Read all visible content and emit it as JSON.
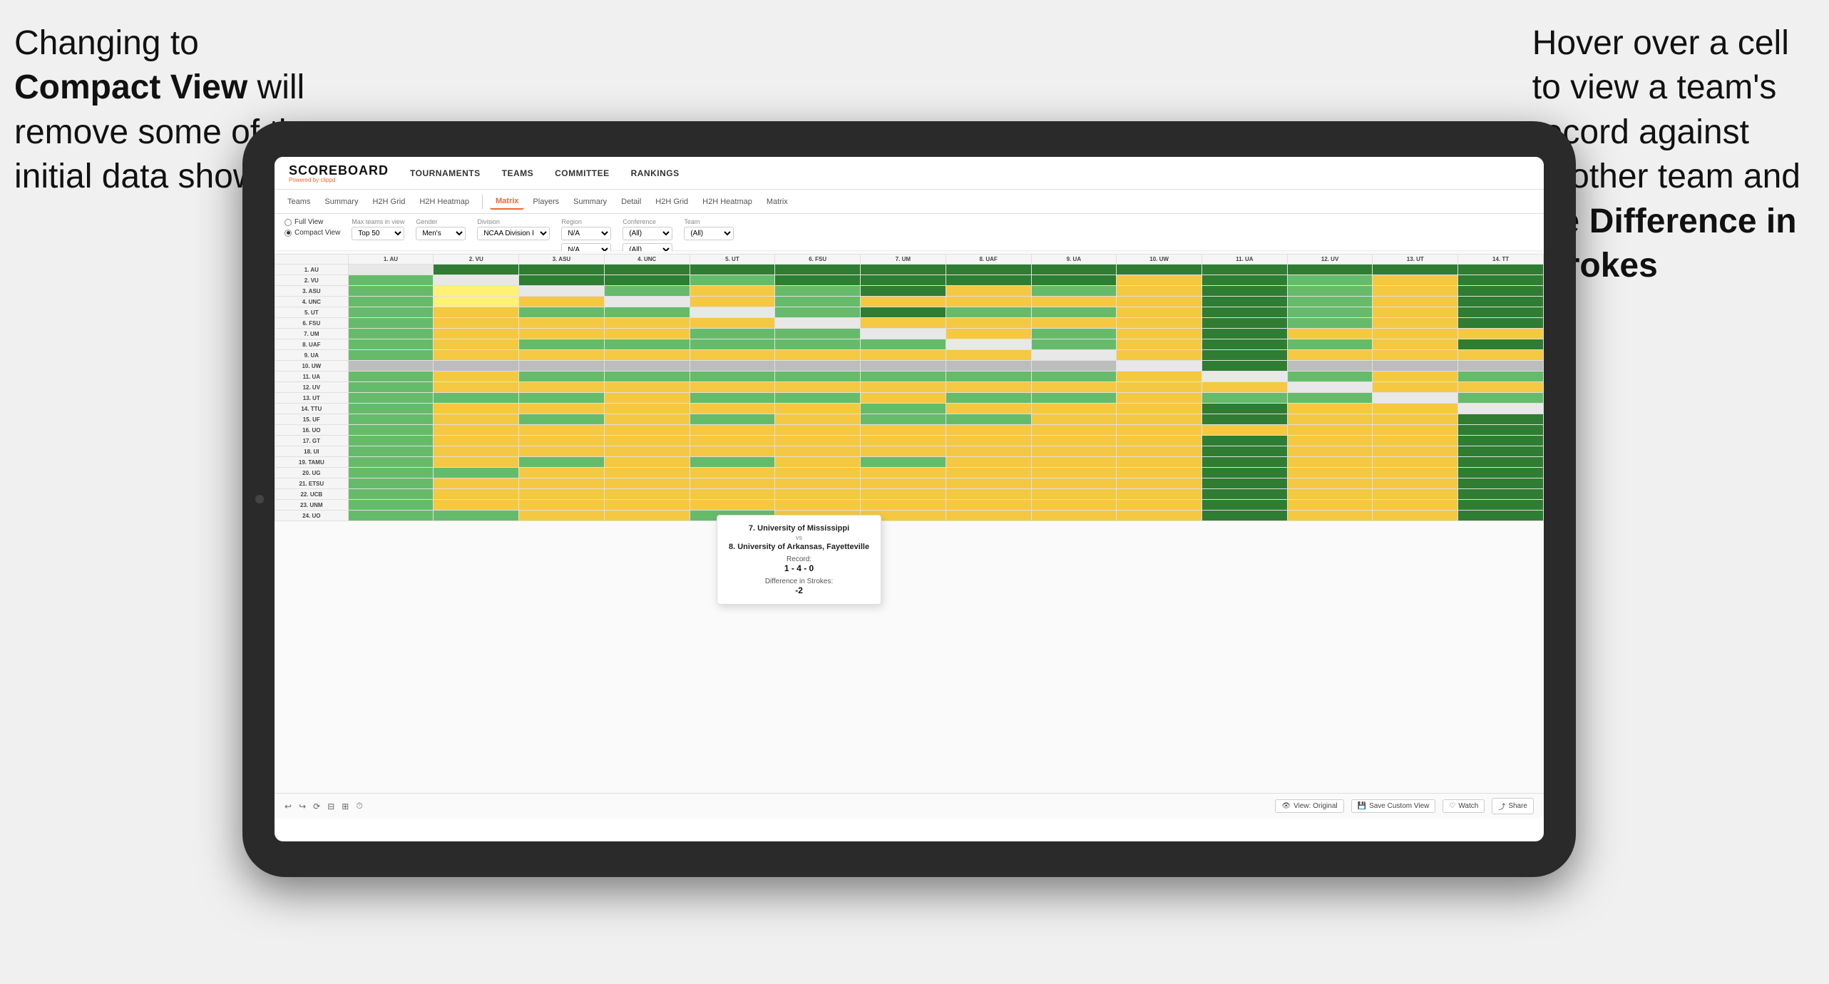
{
  "annotations": {
    "left": {
      "line1": "Changing to",
      "bold": "Compact View",
      "line2": " will",
      "line3": "remove some of the",
      "line4": "initial data shown"
    },
    "right": {
      "line1": "Hover over a cell",
      "line2": "to view a team's",
      "line3": "record against",
      "line4": "another team and",
      "line5": "the ",
      "bold": "Difference in",
      "line6": "Strokes"
    }
  },
  "nav": {
    "logo": "SCOREBOARD",
    "logo_sub": "Powered by clippd",
    "links": [
      "TOURNAMENTS",
      "TEAMS",
      "COMMITTEE",
      "RANKINGS"
    ]
  },
  "sub_tabs_left": [
    "Teams",
    "Summary",
    "H2H Grid",
    "H2H Heatmap"
  ],
  "sub_tabs_right": [
    "Matrix",
    "Players",
    "Summary",
    "Detail",
    "H2H Grid",
    "H2H Heatmap",
    "Matrix"
  ],
  "active_tab": "Matrix",
  "filters": {
    "view_full": "Full View",
    "view_compact": "Compact View",
    "max_teams_label": "Max teams in view",
    "max_teams_value": "Top 50",
    "gender_label": "Gender",
    "gender_value": "Men's",
    "division_label": "Division",
    "division_value": "NCAA Division I",
    "region_label": "Region",
    "region_value": "N/A",
    "conference_label": "Conference",
    "conference_value": "(All)",
    "team_label": "Team",
    "team_value": "(All)"
  },
  "col_headers": [
    "1. AU",
    "2. VU",
    "3. ASU",
    "4. UNC",
    "5. UT",
    "6. FSU",
    "7. UM",
    "8. UAF",
    "9. UA",
    "10. UW",
    "11. UA",
    "12. UV",
    "13. UT",
    "14. TT"
  ],
  "row_labels": [
    "1. AU",
    "2. VU",
    "3. ASU",
    "4. UNC",
    "5. UT",
    "6. FSU",
    "7. UM",
    "8. UAF",
    "9. UA",
    "10. UW",
    "11. UA",
    "12. UV",
    "13. UT",
    "14. TTU",
    "15. UF",
    "16. UO",
    "17. GT",
    "18. UI",
    "19. TAMU",
    "20. UG",
    "21. ETSU",
    "22. UCB",
    "23. UNM",
    "24. UO"
  ],
  "tooltip": {
    "team1": "7. University of Mississippi",
    "vs": "vs",
    "team2": "8. University of Arkansas, Fayetteville",
    "record_label": "Record:",
    "record": "1 - 4 - 0",
    "strokes_label": "Difference in Strokes:",
    "strokes": "-2"
  },
  "toolbar": {
    "view_original": "View: Original",
    "save_custom": "Save Custom View",
    "watch": "Watch",
    "share": "Share"
  }
}
